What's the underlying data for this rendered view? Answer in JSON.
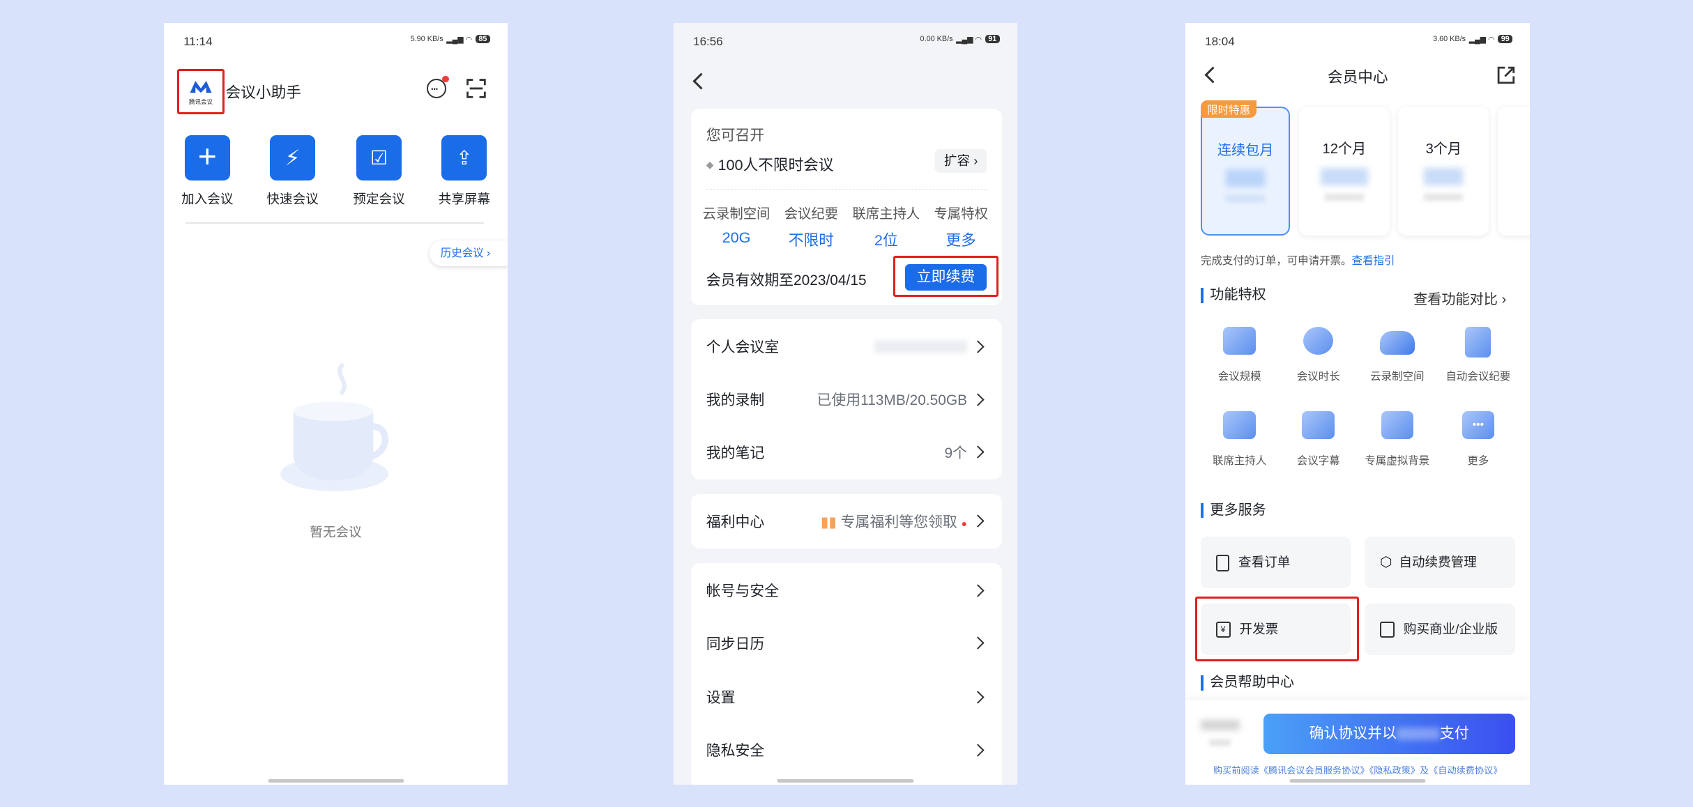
{
  "phone1": {
    "status_time": "11:14",
    "status_net": "5.90 KB/s",
    "status_battery": "85",
    "logo_text": "腾讯会议",
    "app_title": "会议小助手",
    "quick_actions": [
      {
        "label": "加入会议",
        "icon": "plus-icon"
      },
      {
        "label": "快速会议",
        "icon": "lightning-icon"
      },
      {
        "label": "预定会议",
        "icon": "calendar-check-icon"
      },
      {
        "label": "共享屏幕",
        "icon": "share-screen-icon"
      }
    ],
    "history_label": "历史会议",
    "empty_text": "暂无会议"
  },
  "phone2": {
    "status_time": "16:56",
    "status_net": "0.00 KB/s",
    "status_battery": "91",
    "can_open_label": "您可召开",
    "meeting_type": "100人不限时会议",
    "expand_label": "扩容",
    "features": [
      {
        "name": "云录制空间",
        "value": "20G"
      },
      {
        "name": "会议纪要",
        "value": "不限时"
      },
      {
        "name": "联席主持人",
        "value": "2位"
      },
      {
        "name": "专属特权",
        "value": "更多"
      }
    ],
    "validity_text": "会员有效期至2023/04/15",
    "renew_button": "立即续费",
    "group1": [
      {
        "label": "个人会议室",
        "value": ""
      },
      {
        "label": "我的录制",
        "value": "已使用113MB/20.50GB"
      },
      {
        "label": "我的笔记",
        "value": "9个"
      }
    ],
    "welfare": {
      "label": "福利中心",
      "value": "专属福利等您领取"
    },
    "group3": [
      {
        "label": "帐号与安全"
      },
      {
        "label": "同步日历"
      },
      {
        "label": "设置"
      },
      {
        "label": "隐私安全"
      }
    ]
  },
  "phone3": {
    "status_time": "18:04",
    "status_net": "3.60 KB/s",
    "status_battery": "99",
    "page_title": "会员中心",
    "promo_tag": "限时特惠",
    "plans": [
      "连续包月",
      "12个月",
      "3个月"
    ],
    "invoice_note": "完成支付的订单，可申请开票。",
    "invoice_link": "查看指引",
    "features_title": "功能特权",
    "compare_link": "查看功能对比",
    "features": [
      "会议规模",
      "会议时长",
      "云录制空间",
      "自动会议纪要",
      "联席主持人",
      "会议字幕",
      "专属虚拟背景",
      "更多"
    ],
    "services_title": "更多服务",
    "services": [
      "查看订单",
      "自动续费管理",
      "开发票",
      "购买商业/企业版"
    ],
    "help_title": "会员帮助中心",
    "pay_button_prefix": "确认协议并以",
    "pay_button_suffix": "支付",
    "agreement": "购买前阅读《腾讯会议会员服务协议》《隐私政策》及《自动续费协议》"
  }
}
